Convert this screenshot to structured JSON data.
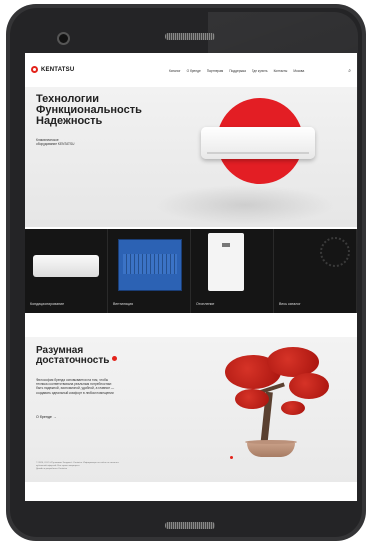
{
  "site": {
    "logo_text": "KENTATSU",
    "brand_color": "#e3231b"
  },
  "nav": {
    "items": [
      "Каталог",
      "О бренде",
      "Партнерам",
      "Поддержка",
      "Где купить",
      "Контакты",
      "Москва"
    ],
    "search_icon": "search-icon"
  },
  "hero": {
    "title_lines": [
      "Технологии",
      "Функциональность",
      "Надежность"
    ],
    "subtitle_lines": [
      "Климатическое",
      "оборудование KENTATSU"
    ]
  },
  "categories": [
    {
      "label": "Кондиционирование",
      "icon": "air-conditioner-image"
    },
    {
      "label": "Вентиляция",
      "icon": "ventilation-unit-image"
    },
    {
      "label": "Отопление",
      "icon": "boiler-image"
    },
    {
      "label": "Весь каталог",
      "icon": "catalog-decor"
    }
  ],
  "about": {
    "title_lines": [
      "Разумная",
      "достаточность"
    ],
    "text_lines": [
      "Философия бренда основывается на том, чтобы",
      "техника соответствовала реальным потребностям:",
      "быть надежной, экономичной, удобной, а главное —",
      "создавать идеальный комфорт в любом помещении"
    ],
    "link_label": "О бренде",
    "footer_lines": [
      "© 2024, ООО «Русклимат Холдинг». Kentatsu. Информация на сайте не является",
      "публичной офертой. Все права защищены.",
      "Дизайн и разработка: Kentatsu"
    ]
  }
}
